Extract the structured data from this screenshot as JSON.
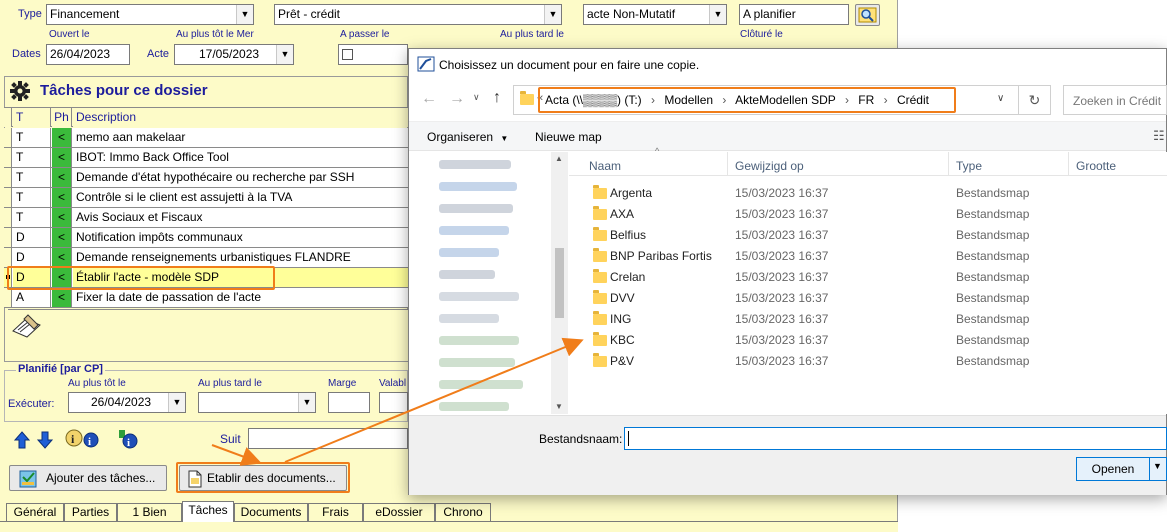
{
  "app": {
    "type_label": "Type",
    "type_value": "Financement",
    "subtype_value": "Prêt - crédit",
    "acte_kind_value": "acte Non-Mutatif",
    "status_value": "A planifier",
    "dates_label": "Dates",
    "ouvert_le_label": "Ouvert le",
    "ouvert_le_value": "26/04/2023",
    "acte_label": "Acte",
    "au_plus_tot_label": "Au plus tôt le Mer",
    "acte_date_value": "17/05/2023",
    "a_passer_label": "A passer le",
    "au_plus_tard_label": "Au plus tard le",
    "cloture_label": "Clôturé le",
    "tasks_title": "Tâches pour ce dossier",
    "grid_headers": {
      "t": "T",
      "ph": "Ph",
      "desc": "Description"
    },
    "tasks": [
      {
        "t": "T",
        "ph": "<",
        "desc": "memo aan makelaar"
      },
      {
        "t": "T",
        "ph": "<",
        "desc": "IBOT: Immo Back Office Tool"
      },
      {
        "t": "T",
        "ph": "<",
        "desc": "Demande d'état hypothécaire ou recherche par SSH"
      },
      {
        "t": "T",
        "ph": "<",
        "desc": "Contrôle si le client est assujetti à la TVA"
      },
      {
        "t": "T",
        "ph": "<",
        "desc": "Avis Sociaux et Fiscaux"
      },
      {
        "t": "D",
        "ph": "<",
        "desc": "Notification impôts communaux"
      },
      {
        "t": "D",
        "ph": "<",
        "desc": "Demande renseignements urbanistiques FLANDRE"
      },
      {
        "t": "D",
        "ph": "<",
        "desc": "Établir l'acte - modèle SDP"
      },
      {
        "t": "A",
        "ph": "<",
        "desc": "Fixer la date de passation de l'acte"
      }
    ],
    "planned_title": "Planifié  [par CP]",
    "plan_au_plus_tot": "Au plus tôt le",
    "plan_au_plus_tard": "Au plus tard le",
    "plan_marge": "Marge",
    "plan_valable": "Valabl",
    "executer_label": "Exécuter:",
    "executer_date": "26/04/2023",
    "suit_label": "Suit",
    "add_tasks_button": "Ajouter des tâches...",
    "make_docs_button": "Etablir des documents...",
    "tabs": [
      "Général",
      "Parties",
      "1 Bien",
      "Tâches",
      "Documents",
      "Frais",
      "eDossier",
      "Chrono"
    ]
  },
  "dialog": {
    "title": "Choisissez un document pour en faire une copie.",
    "breadcrumb": {
      "prefix": "«",
      "parts": [
        "Acta (\\\\▒▒▒▒) (T:)",
        "Modellen",
        "AkteModellen SDP",
        "FR",
        "Crédit"
      ]
    },
    "search_placeholder": "Zoeken in Crédit",
    "organize": "Organiseren",
    "new_folder": "Nieuwe map",
    "columns": {
      "name": "Naam",
      "modified": "Gewijzigd op",
      "type": "Type",
      "size": "Grootte"
    },
    "folders": [
      {
        "name": "Argenta",
        "modified": "15/03/2023 16:37",
        "type": "Bestandsmap"
      },
      {
        "name": "AXA",
        "modified": "15/03/2023 16:37",
        "type": "Bestandsmap"
      },
      {
        "name": "Belfius",
        "modified": "15/03/2023 16:37",
        "type": "Bestandsmap"
      },
      {
        "name": "BNP Paribas Fortis",
        "modified": "15/03/2023 16:37",
        "type": "Bestandsmap"
      },
      {
        "name": "Crelan",
        "modified": "15/03/2023 16:37",
        "type": "Bestandsmap"
      },
      {
        "name": "DVV",
        "modified": "15/03/2023 16:37",
        "type": "Bestandsmap"
      },
      {
        "name": "ING",
        "modified": "15/03/2023 16:37",
        "type": "Bestandsmap"
      },
      {
        "name": "KBC",
        "modified": "15/03/2023 16:37",
        "type": "Bestandsmap"
      },
      {
        "name": "P&V",
        "modified": "15/03/2023 16:37",
        "type": "Bestandsmap"
      }
    ],
    "filename_label": "Bestandsnaam:",
    "filename_value": "",
    "open_button": "Openen"
  },
  "colors": {
    "highlight": "#f07d1a",
    "app_bg": "#fdfbc8",
    "phase_green": "#3bba3b",
    "label_blue": "#1c1c9c"
  }
}
